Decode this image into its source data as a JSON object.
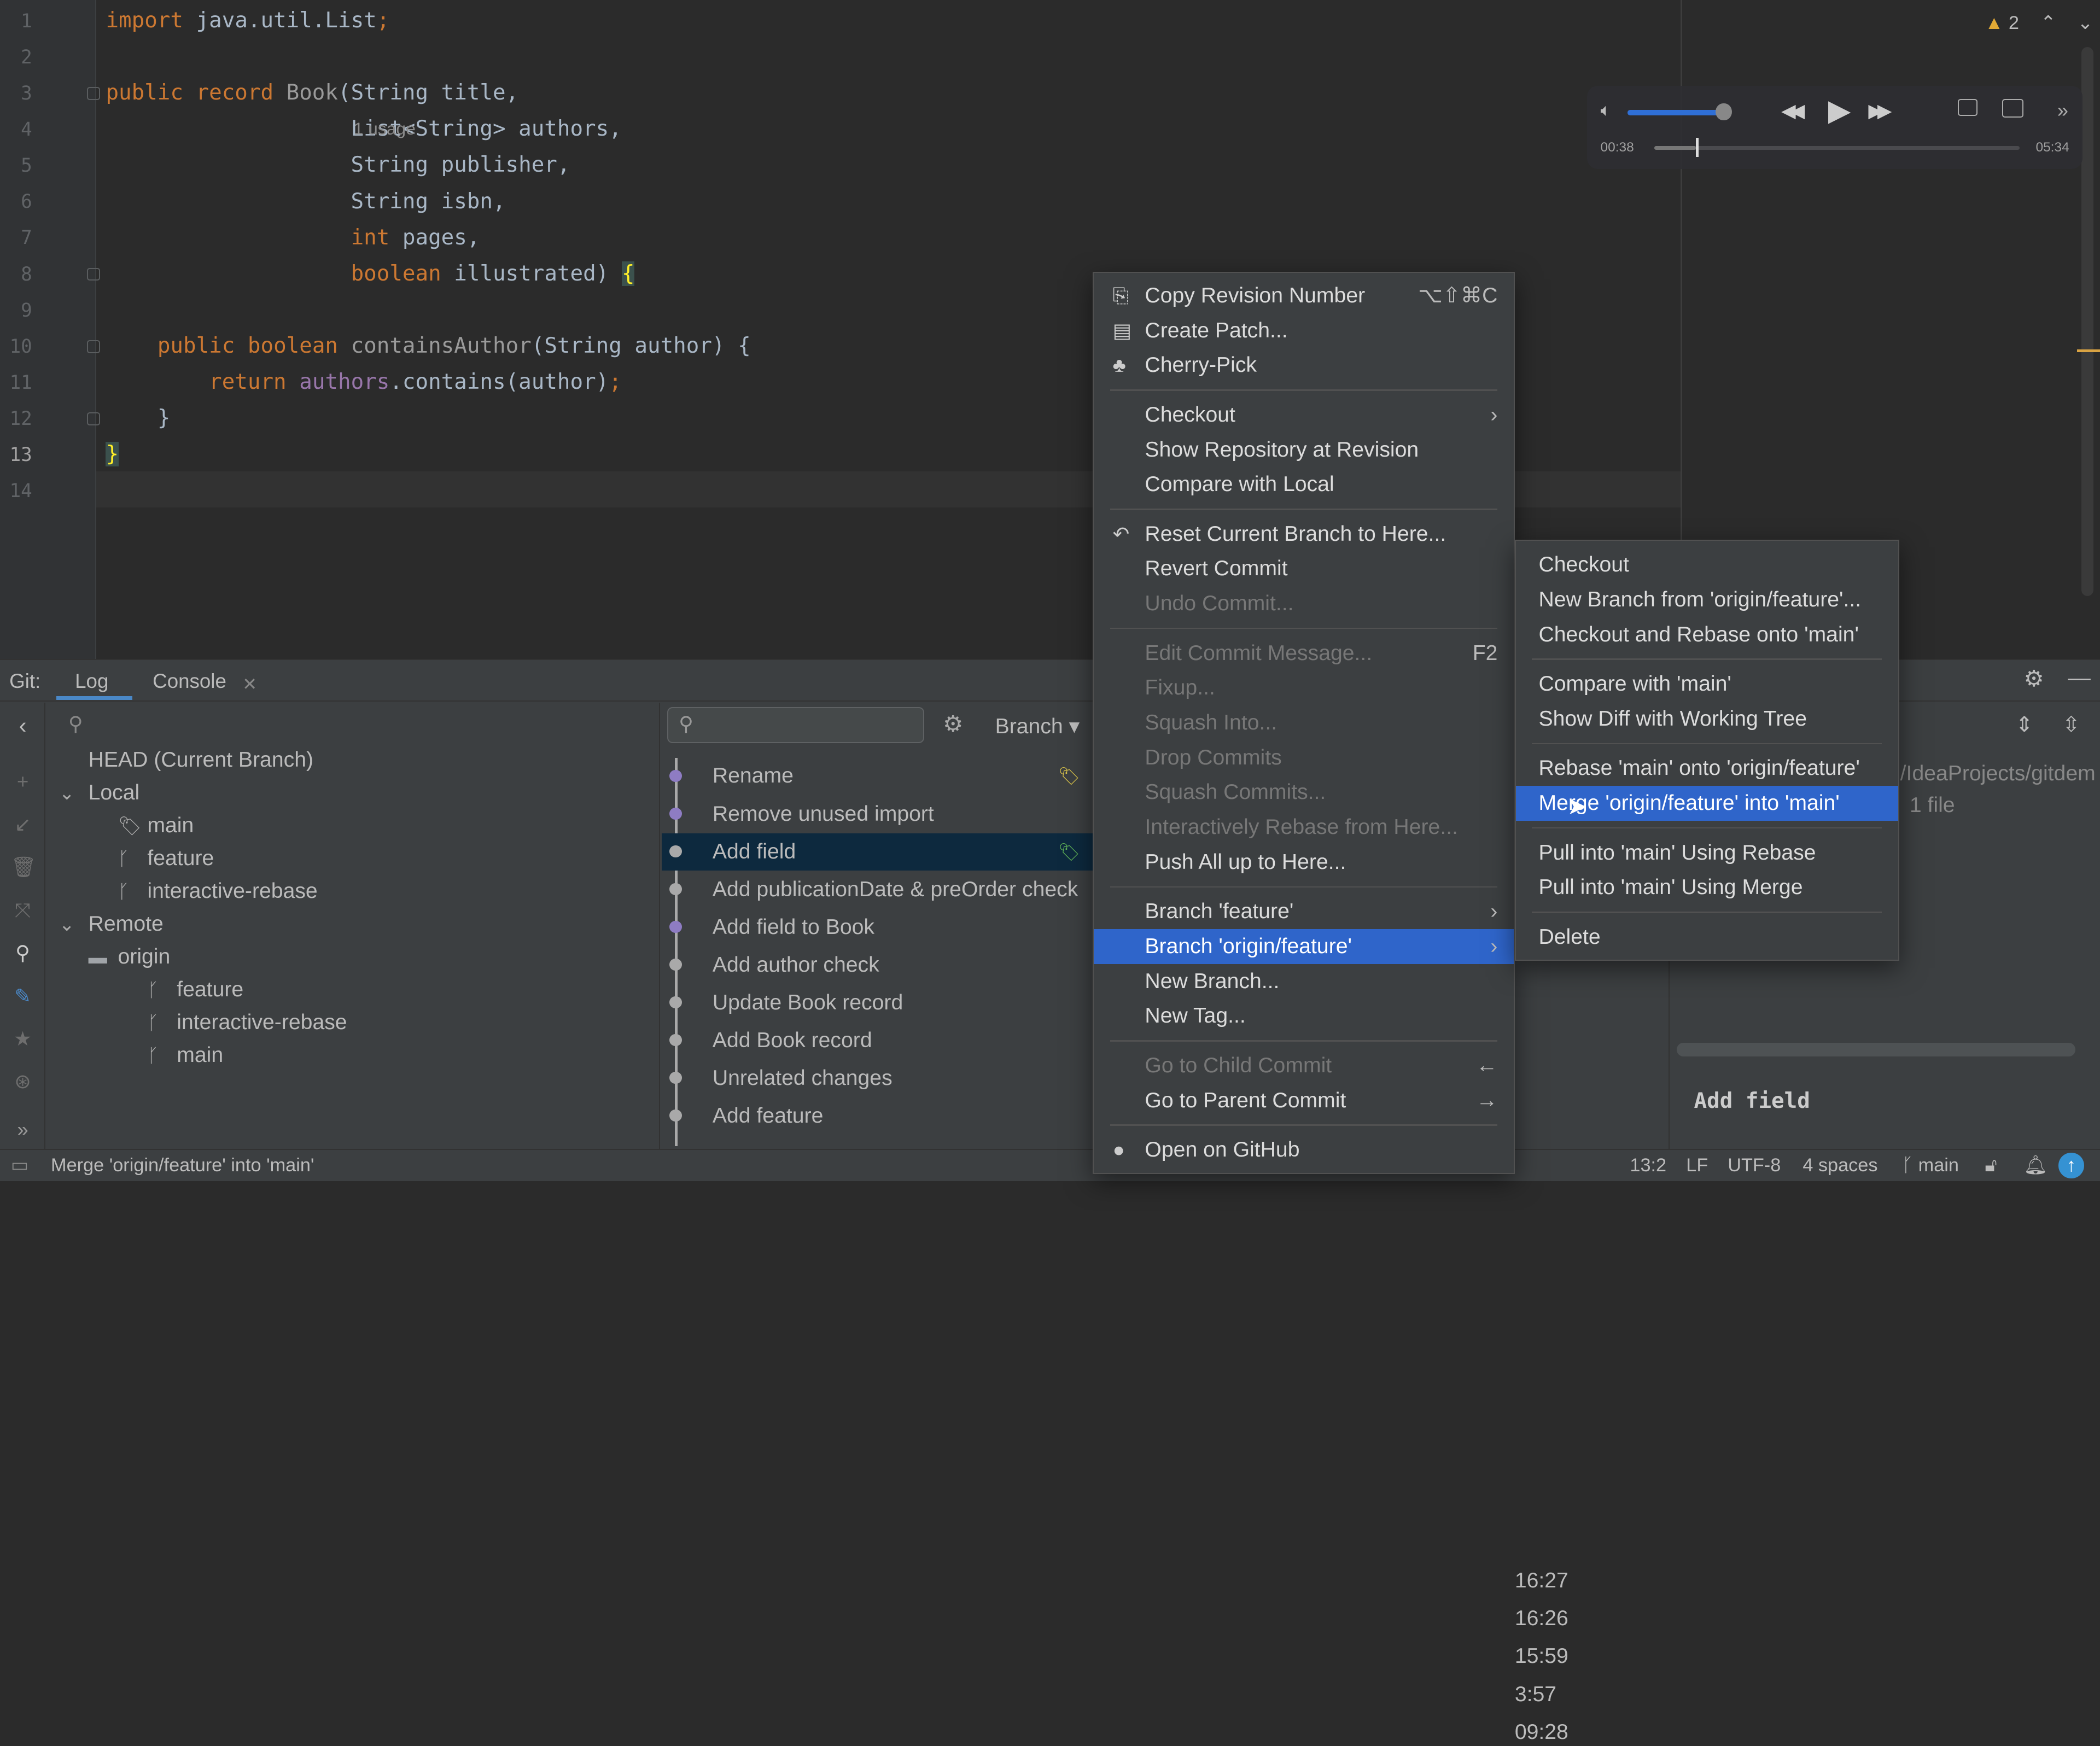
{
  "editor": {
    "line_numbers": [
      "1",
      "2",
      "3",
      "4",
      "5",
      "6",
      "7",
      "8",
      "9",
      "10",
      "11",
      "12",
      "13",
      "14"
    ],
    "current_line": 13,
    "lines": [
      {
        "line": 1,
        "tokens": [
          [
            "import",
            "kw"
          ],
          [
            " java.util.List",
            ""
          ],
          [
            ";",
            "kw"
          ]
        ]
      },
      {
        "line": 3,
        "tokens": [
          [
            "public record ",
            "kw"
          ],
          [
            "Book",
            "dim"
          ],
          [
            "(String title,",
            ""
          ]
        ]
      },
      {
        "line": 4,
        "tokens": [
          [
            "                   List<String> authors,",
            ""
          ]
        ]
      },
      {
        "line": 5,
        "tokens": [
          [
            "                   String publisher,",
            ""
          ]
        ]
      },
      {
        "line": 6,
        "tokens": [
          [
            "                   String isbn,",
            ""
          ]
        ]
      },
      {
        "line": 7,
        "tokens": [
          [
            "                   ",
            ""
          ],
          [
            "int",
            "kw"
          ],
          [
            " pages,",
            ""
          ]
        ]
      },
      {
        "line": 8,
        "tokens": [
          [
            "                   ",
            ""
          ],
          [
            "boolean",
            "kw"
          ],
          [
            " illustrated) ",
            ""
          ],
          [
            "{",
            "brace"
          ]
        ]
      },
      {
        "line": 10,
        "tokens": [
          [
            "    ",
            ""
          ],
          [
            "public boolean ",
            "kw"
          ],
          [
            "containsAuthor",
            "dim"
          ],
          [
            "(String author) {",
            ""
          ]
        ]
      },
      {
        "line": 11,
        "tokens": [
          [
            "        ",
            ""
          ],
          [
            "return ",
            "kw"
          ],
          [
            "authors",
            "pur"
          ],
          [
            ".contains(author)",
            ""
          ],
          [
            ";",
            "kw"
          ]
        ]
      },
      {
        "line": 12,
        "tokens": [
          [
            "    }",
            ""
          ]
        ]
      },
      {
        "line": 13,
        "tokens": [
          [
            "}",
            "brace"
          ]
        ]
      }
    ],
    "inlay_hint": "1 usage",
    "warning_count": "2"
  },
  "video_player": {
    "elapsed": "00:38",
    "duration": "05:34",
    "progress_fraction": 0.114,
    "volume_fraction": 1.0,
    "volume_color": "#2f6fd6"
  },
  "git": {
    "label": "Git:",
    "tabs": [
      {
        "label": "Log",
        "active": true
      },
      {
        "label": "Console",
        "active": false
      }
    ],
    "branch_filter": "Branch",
    "tree": [
      {
        "label": "HEAD (Current Branch)",
        "level": 0,
        "icon": ""
      },
      {
        "label": "Local",
        "level": 0,
        "icon": "chevron-down"
      },
      {
        "label": "main",
        "level": 2,
        "icon": "tag"
      },
      {
        "label": "feature",
        "level": 2,
        "icon": "branch"
      },
      {
        "label": "interactive-rebase",
        "level": 2,
        "icon": "branch"
      },
      {
        "label": "Remote",
        "level": 0,
        "icon": "chevron-down"
      },
      {
        "label": "origin",
        "level": 1,
        "icon": "folder"
      },
      {
        "label": "feature",
        "level": 3,
        "icon": "branch"
      },
      {
        "label": "interactive-rebase",
        "level": 3,
        "icon": "branch"
      },
      {
        "label": "main",
        "level": 3,
        "icon": "branch"
      }
    ],
    "commits": [
      {
        "message": "Rename",
        "time": ""
      },
      {
        "message": "Remove unused import",
        "time": ""
      },
      {
        "message": "Add field",
        "time": "",
        "selected": true
      },
      {
        "message": "Add publicationDate & preOrder check",
        "time": ""
      },
      {
        "message": "Add field to Book",
        "time": ""
      },
      {
        "message": "Add author check",
        "time": "16:27"
      },
      {
        "message": "Update Book record",
        "time": "16:26"
      },
      {
        "message": "Add Book record",
        "time": "15:59"
      },
      {
        "message": "Unrelated changes",
        "time": "3:57"
      },
      {
        "message": "Add feature",
        "time": "09:28"
      }
    ],
    "details": {
      "path": "/IdeaProjects/gitdem",
      "files": "1 file",
      "commit_message": "Add field"
    }
  },
  "context_menu": {
    "items": [
      {
        "label": "Copy Revision Number",
        "shortcut": "⌥⇧⌘C",
        "icon": "copy"
      },
      {
        "label": "Create Patch...",
        "icon": "patch"
      },
      {
        "label": "Cherry-Pick",
        "icon": "cherry"
      },
      {
        "sep": true
      },
      {
        "label": "Checkout",
        "submenu": true
      },
      {
        "label": "Show Repository at Revision"
      },
      {
        "label": "Compare with Local"
      },
      {
        "sep": true
      },
      {
        "label": "Reset Current Branch to Here...",
        "icon": "undo"
      },
      {
        "label": "Revert Commit"
      },
      {
        "label": "Undo Commit...",
        "disabled": true
      },
      {
        "sep": true
      },
      {
        "label": "Edit Commit Message...",
        "shortcut": "F2",
        "disabled": true
      },
      {
        "label": "Fixup...",
        "disabled": true
      },
      {
        "label": "Squash Into...",
        "disabled": true
      },
      {
        "label": "Drop Commits",
        "disabled": true
      },
      {
        "label": "Squash Commits...",
        "disabled": true
      },
      {
        "label": "Interactively Rebase from Here...",
        "disabled": true
      },
      {
        "label": "Push All up to Here..."
      },
      {
        "sep": true
      },
      {
        "label": "Branch 'feature'",
        "submenu": true
      },
      {
        "label": "Branch 'origin/feature'",
        "submenu": true,
        "highlighted": true
      },
      {
        "label": "New Branch..."
      },
      {
        "label": "New Tag..."
      },
      {
        "sep": true
      },
      {
        "label": "Go to Child Commit",
        "shortcut": "←",
        "disabled": true
      },
      {
        "label": "Go to Parent Commit",
        "shortcut": "→"
      },
      {
        "sep": true
      },
      {
        "label": "Open on GitHub",
        "icon": "github"
      }
    ]
  },
  "submenu": {
    "items": [
      {
        "label": "Checkout"
      },
      {
        "label": "New Branch from 'origin/feature'..."
      },
      {
        "label": "Checkout and Rebase onto 'main'"
      },
      {
        "sep": true
      },
      {
        "label": "Compare with 'main'"
      },
      {
        "label": "Show Diff with Working Tree"
      },
      {
        "sep": true
      },
      {
        "label": "Rebase 'main' onto 'origin/feature'"
      },
      {
        "label": "Merge 'origin/feature' into 'main'",
        "highlighted": true
      },
      {
        "sep": true
      },
      {
        "label": "Pull into 'main' Using Rebase"
      },
      {
        "label": "Pull into 'main' Using Merge"
      },
      {
        "sep": true
      },
      {
        "label": "Delete"
      }
    ]
  },
  "status_bar": {
    "message": "Merge 'origin/feature' into 'main'",
    "position": "13:2",
    "line_ending": "LF",
    "encoding": "UTF-8",
    "indent": "4 spaces",
    "branch": "main"
  },
  "colors": {
    "accent": "#2f65ca",
    "selection": "#0d293e",
    "keyword": "#cc7832"
  }
}
